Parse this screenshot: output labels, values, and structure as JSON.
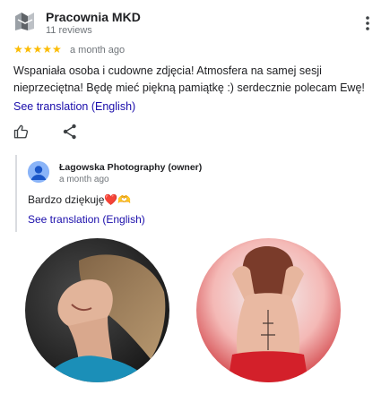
{
  "review": {
    "author": "Pracownia MKD",
    "reviews_count": "11 reviews",
    "rating_stars": "★★★★★",
    "rating_value": 5,
    "time": "a month ago",
    "text": "Wspaniała osoba i cudowne zdjęcia! Atmosfera na samej sesji nieprzeciętna! Będę mieć piękną pamiątkę :) serdecznie polecam Ewę!",
    "see_translation": "See translation (English)"
  },
  "reply": {
    "owner_name": "Łagowska Photography (owner)",
    "time": "a month ago",
    "text": "Bardzo dziękuję❤️🫶",
    "see_translation": "See translation (English)"
  },
  "icons": {
    "avatar": "avatar-icon",
    "more": "more-vert-icon",
    "like": "thumb-up-icon",
    "share": "share-icon",
    "owner_avatar": "person-icon"
  },
  "colors": {
    "star": "#fbbc04",
    "link": "#1a0dab",
    "muted": "#70757a",
    "owner_avatar_bg": "#8ab4f8",
    "photo2_bg": "#c9232a"
  }
}
